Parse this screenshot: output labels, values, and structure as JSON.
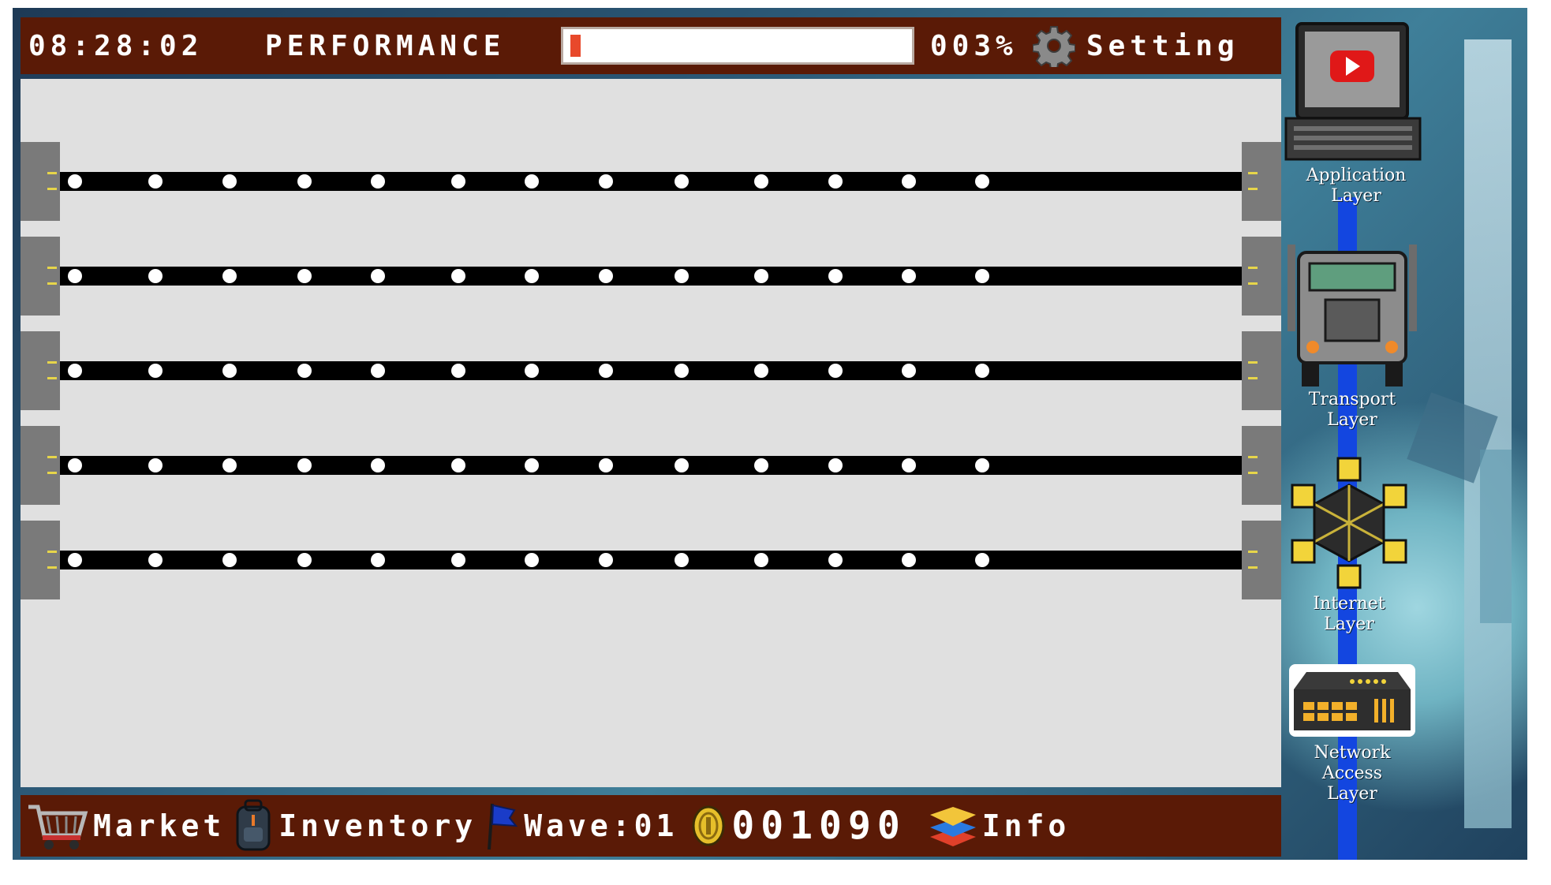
{
  "hud": {
    "clock": "08:28:02",
    "performance_label": "PERFORMANCE",
    "performance_value": 0.03,
    "percent_text": "003%",
    "settings_label": "Setting"
  },
  "board": {
    "lanes": 5,
    "dots_per_lane": 13
  },
  "layers": [
    {
      "label": "Application Layer",
      "icon": "computer-monitor-icon"
    },
    {
      "label": "Transport Layer",
      "icon": "truck-icon"
    },
    {
      "label": "Internet Layer",
      "icon": "network-cubes-icon"
    },
    {
      "label": "Network Access Layer",
      "icon": "router-icon"
    }
  ],
  "bottom": {
    "market_label": "Market",
    "inventory_label": "Inventory",
    "wave_label": "Wave:01",
    "coins": "001090",
    "info_label": "Info"
  },
  "colors": {
    "bar_bg": "#5a1a06",
    "board_bg": "#e0e0e0",
    "performance_fill": "#e8492b",
    "layer_line": "#1346e0"
  }
}
